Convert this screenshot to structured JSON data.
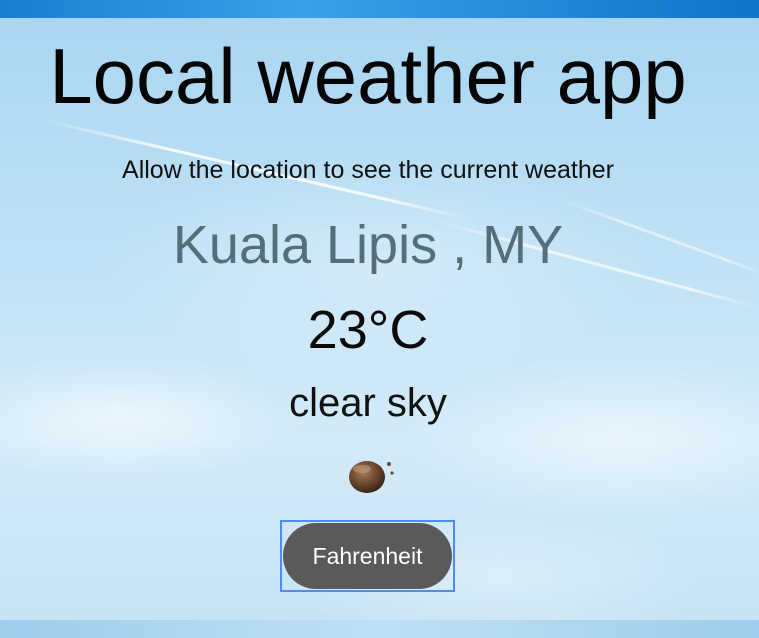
{
  "app": {
    "title": "Local weather app",
    "subtitle": "Allow the location to see the current weather"
  },
  "weather": {
    "location": "Kuala Lipis , MY",
    "temperature": "23°C",
    "description": "clear sky",
    "icon": "clear-sky-moon-icon"
  },
  "controls": {
    "unit_toggle_label": "Fahrenheit"
  },
  "colors": {
    "location_text": "#546e7a",
    "button_bg": "#5a5a5a",
    "button_focus_outline": "#4f8de8"
  }
}
